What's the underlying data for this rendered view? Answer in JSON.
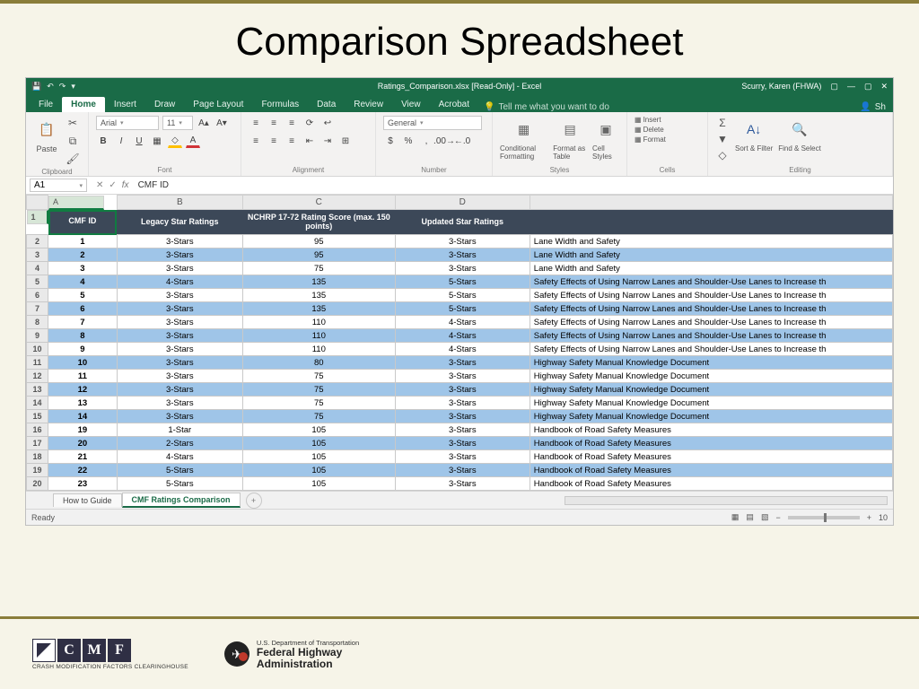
{
  "slide": {
    "title": "Comparison Spreadsheet"
  },
  "titlebar": {
    "doc": "Ratings_Comparison.xlsx  [Read-Only]  -  Excel",
    "user": "Scurry, Karen (FHWA)"
  },
  "tabs": [
    "File",
    "Home",
    "Insert",
    "Draw",
    "Page Layout",
    "Formulas",
    "Data",
    "Review",
    "View",
    "Acrobat"
  ],
  "tell_me": "Tell me what you want to do",
  "share": "Sh",
  "ribbon": {
    "clipboard": "Clipboard",
    "paste": "Paste",
    "font": "Font",
    "font_name": "Arial",
    "font_size": "11",
    "alignment": "Alignment",
    "number": "Number",
    "number_format": "General",
    "styles": "Styles",
    "cond_fmt": "Conditional Formatting",
    "fmt_table": "Format as Table",
    "cell_styles": "Cell Styles",
    "cells": "Cells",
    "insert": "Insert",
    "delete": "Delete",
    "format": "Format",
    "editing": "Editing",
    "sort": "Sort & Filter",
    "find": "Find & Select"
  },
  "fx": {
    "name": "A1",
    "formula": "CMF ID"
  },
  "cols": [
    "A",
    "B",
    "C",
    "D",
    ""
  ],
  "headers": {
    "a": "CMF ID",
    "b": "Legacy Star Ratings",
    "c": "NCHRP 17-72 Rating Score (max. 150 points)",
    "d": "Updated Star Ratings"
  },
  "rows": [
    {
      "n": 2,
      "blue": false,
      "a": "1",
      "b": "3-Stars",
      "c": "95",
      "d": "3-Stars",
      "e": "Lane Width and Safety"
    },
    {
      "n": 3,
      "blue": true,
      "a": "2",
      "b": "3-Stars",
      "c": "95",
      "d": "3-Stars",
      "e": "Lane Width and Safety"
    },
    {
      "n": 4,
      "blue": false,
      "a": "3",
      "b": "3-Stars",
      "c": "75",
      "d": "3-Stars",
      "e": "Lane Width and Safety"
    },
    {
      "n": 5,
      "blue": true,
      "a": "4",
      "b": "4-Stars",
      "c": "135",
      "d": "5-Stars",
      "e": "Safety Effects of Using Narrow Lanes and Shoulder-Use Lanes to Increase th"
    },
    {
      "n": 6,
      "blue": false,
      "a": "5",
      "b": "3-Stars",
      "c": "135",
      "d": "5-Stars",
      "e": "Safety Effects of Using Narrow Lanes and Shoulder-Use Lanes to Increase th"
    },
    {
      "n": 7,
      "blue": true,
      "a": "6",
      "b": "3-Stars",
      "c": "135",
      "d": "5-Stars",
      "e": "Safety Effects of Using Narrow Lanes and Shoulder-Use Lanes to Increase th"
    },
    {
      "n": 8,
      "blue": false,
      "a": "7",
      "b": "3-Stars",
      "c": "110",
      "d": "4-Stars",
      "e": "Safety Effects of Using Narrow Lanes and Shoulder-Use Lanes to Increase th"
    },
    {
      "n": 9,
      "blue": true,
      "a": "8",
      "b": "3-Stars",
      "c": "110",
      "d": "4-Stars",
      "e": "Safety Effects of Using Narrow Lanes and Shoulder-Use Lanes to Increase th"
    },
    {
      "n": 10,
      "blue": false,
      "a": "9",
      "b": "3-Stars",
      "c": "110",
      "d": "4-Stars",
      "e": "Safety Effects of Using Narrow Lanes and Shoulder-Use Lanes to Increase th"
    },
    {
      "n": 11,
      "blue": true,
      "a": "10",
      "b": "3-Stars",
      "c": "80",
      "d": "3-Stars",
      "e": "Highway Safety Manual Knowledge Document"
    },
    {
      "n": 12,
      "blue": false,
      "a": "11",
      "b": "3-Stars",
      "c": "75",
      "d": "3-Stars",
      "e": "Highway Safety Manual Knowledge Document"
    },
    {
      "n": 13,
      "blue": true,
      "a": "12",
      "b": "3-Stars",
      "c": "75",
      "d": "3-Stars",
      "e": "Highway Safety Manual Knowledge Document"
    },
    {
      "n": 14,
      "blue": false,
      "a": "13",
      "b": "3-Stars",
      "c": "75",
      "d": "3-Stars",
      "e": "Highway Safety Manual Knowledge Document"
    },
    {
      "n": 15,
      "blue": true,
      "a": "14",
      "b": "3-Stars",
      "c": "75",
      "d": "3-Stars",
      "e": "Highway Safety Manual Knowledge Document"
    },
    {
      "n": 16,
      "blue": false,
      "a": "19",
      "b": "1-Star",
      "c": "105",
      "d": "3-Stars",
      "e": "Handbook of Road Safety Measures"
    },
    {
      "n": 17,
      "blue": true,
      "a": "20",
      "b": "2-Stars",
      "c": "105",
      "d": "3-Stars",
      "e": "Handbook of Road Safety Measures"
    },
    {
      "n": 18,
      "blue": false,
      "a": "21",
      "b": "4-Stars",
      "c": "105",
      "d": "3-Stars",
      "e": "Handbook of Road Safety Measures"
    },
    {
      "n": 19,
      "blue": true,
      "a": "22",
      "b": "5-Stars",
      "c": "105",
      "d": "3-Stars",
      "e": "Handbook of Road Safety Measures"
    },
    {
      "n": 20,
      "blue": false,
      "a": "23",
      "b": "5-Stars",
      "c": "105",
      "d": "3-Stars",
      "e": "Handbook of Road Safety Measures"
    }
  ],
  "sheet_tabs": {
    "guide": "How to Guide",
    "active": "CMF Ratings Comparison"
  },
  "status": {
    "ready": "Ready",
    "zoom": "10"
  },
  "footer": {
    "cmf_tag": "CRASH MODIFICATION FACTORS CLEARINGHOUSE",
    "fhwa_dept": "U.S. Department of Transportation",
    "fhwa1": "Federal Highway",
    "fhwa2": "Administration"
  }
}
